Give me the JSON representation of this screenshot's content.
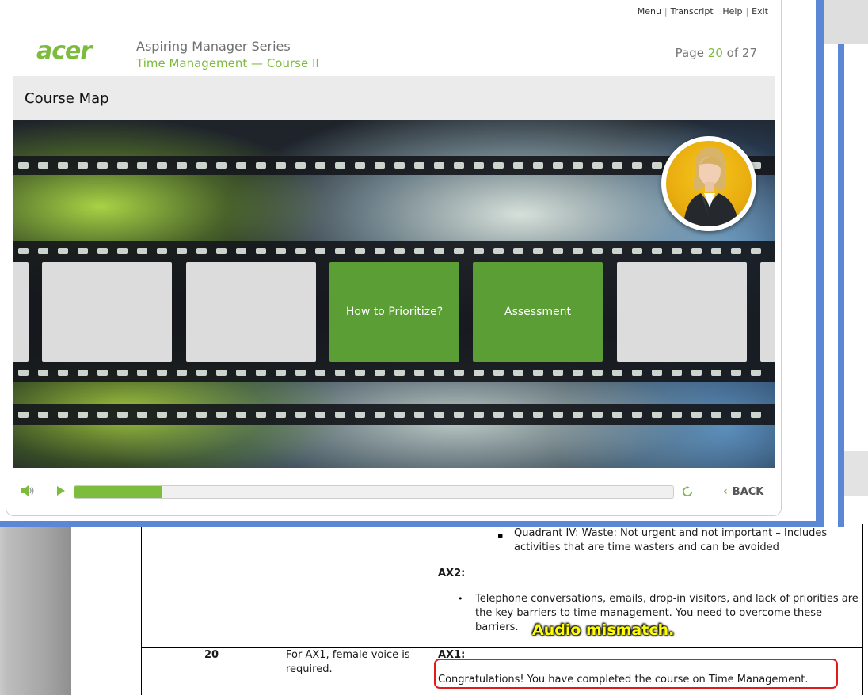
{
  "topnav": {
    "menu": "Menu",
    "transcript": "Transcript",
    "help": "Help",
    "exit": "Exit",
    "separator": "|"
  },
  "header": {
    "logo_text": "acer",
    "series_title": "Aspiring Manager Series",
    "course_title": "Time Management — Course II",
    "page_prefix": "Page",
    "page_current": "20",
    "page_of": "of",
    "page_total": "27"
  },
  "slide": {
    "title": "Course Map",
    "frames": [
      {
        "label": "",
        "style": "grey"
      },
      {
        "label": "",
        "style": "grey"
      },
      {
        "label": "How to Prioritize?",
        "style": "green"
      },
      {
        "label": "Assessment",
        "style": "green"
      },
      {
        "label": "",
        "style": "grey"
      }
    ]
  },
  "controls": {
    "progress": 0.145,
    "back_label": "BACK"
  },
  "document": {
    "bullet_quadrant_iv": "Quadrant IV: Waste: Not urgent and not important – Includes activities that are time wasters and can be avoided",
    "ax2_label": "AX2:",
    "bullet_telephone": "Telephone conversations, emails, drop-in visitors, and lack of priorities are the key barriers to time management. You need to overcome these barriers.",
    "row_number": "20",
    "row_note": "For AX1, female voice is required.",
    "ax1_label": "AX1:",
    "ax1_text": "Congratulations!  You have completed the course on Time Management.",
    "annotation": "Audio mismatch."
  },
  "colors": {
    "accent_green": "#7dbb3c",
    "frame_green": "#5a9e35",
    "window_blue": "#5b87d6",
    "highlight_red": "#e11b1b",
    "annotation_yellow": "#ffff00"
  }
}
